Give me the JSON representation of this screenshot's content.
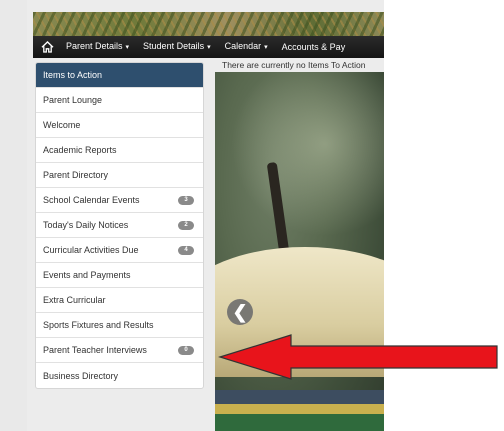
{
  "navbar": {
    "items": [
      {
        "label": "Parent Details",
        "caret": "▾"
      },
      {
        "label": "Student Details",
        "caret": "▾"
      },
      {
        "label": "Calendar",
        "caret": "▾"
      },
      {
        "label": "Accounts & Pay",
        "caret": ""
      }
    ]
  },
  "sidebar": {
    "items": [
      {
        "label": "Items to Action",
        "badge": ""
      },
      {
        "label": "Parent Lounge",
        "badge": ""
      },
      {
        "label": "Welcome",
        "badge": ""
      },
      {
        "label": "Academic Reports",
        "badge": ""
      },
      {
        "label": "Parent Directory",
        "badge": ""
      },
      {
        "label": "School Calendar Events",
        "badge": "3"
      },
      {
        "label": "Today's Daily Notices",
        "badge": "2"
      },
      {
        "label": "Curricular Activities Due",
        "badge": "4"
      },
      {
        "label": "Events and Payments",
        "badge": ""
      },
      {
        "label": "Extra Curricular",
        "badge": ""
      },
      {
        "label": "Sports Fixtures and Results",
        "badge": ""
      },
      {
        "label": "Parent Teacher Interviews",
        "badge": "0"
      },
      {
        "label": "Business Directory",
        "badge": ""
      }
    ]
  },
  "main": {
    "notice": "There are currently no Items To Action",
    "carousel_prev_glyph": "❮"
  },
  "colors": {
    "active_item": "#2e4f6e",
    "badge": "#8a8a8a",
    "arrow": "#e8141b"
  },
  "icons": {
    "home": "home-icon",
    "prev": "chevron-left-icon",
    "annotation": "red-arrow-icon"
  }
}
